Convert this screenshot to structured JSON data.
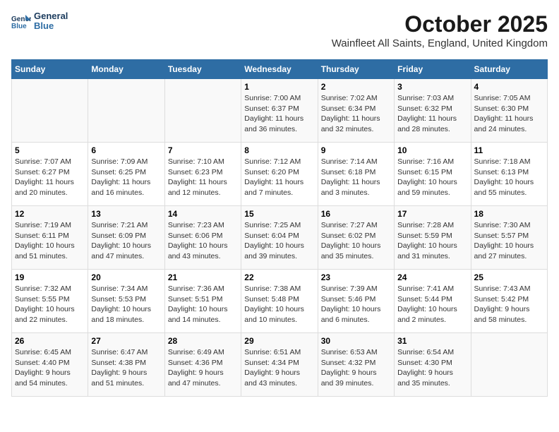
{
  "logo": {
    "line1": "General",
    "line2": "Blue"
  },
  "title": "October 2025",
  "subtitle": "Wainfleet All Saints, England, United Kingdom",
  "days_of_week": [
    "Sunday",
    "Monday",
    "Tuesday",
    "Wednesday",
    "Thursday",
    "Friday",
    "Saturday"
  ],
  "weeks": [
    [
      {
        "day": "",
        "info": ""
      },
      {
        "day": "",
        "info": ""
      },
      {
        "day": "",
        "info": ""
      },
      {
        "day": "1",
        "info": "Sunrise: 7:00 AM\nSunset: 6:37 PM\nDaylight: 11 hours\nand 36 minutes."
      },
      {
        "day": "2",
        "info": "Sunrise: 7:02 AM\nSunset: 6:34 PM\nDaylight: 11 hours\nand 32 minutes."
      },
      {
        "day": "3",
        "info": "Sunrise: 7:03 AM\nSunset: 6:32 PM\nDaylight: 11 hours\nand 28 minutes."
      },
      {
        "day": "4",
        "info": "Sunrise: 7:05 AM\nSunset: 6:30 PM\nDaylight: 11 hours\nand 24 minutes."
      }
    ],
    [
      {
        "day": "5",
        "info": "Sunrise: 7:07 AM\nSunset: 6:27 PM\nDaylight: 11 hours\nand 20 minutes."
      },
      {
        "day": "6",
        "info": "Sunrise: 7:09 AM\nSunset: 6:25 PM\nDaylight: 11 hours\nand 16 minutes."
      },
      {
        "day": "7",
        "info": "Sunrise: 7:10 AM\nSunset: 6:23 PM\nDaylight: 11 hours\nand 12 minutes."
      },
      {
        "day": "8",
        "info": "Sunrise: 7:12 AM\nSunset: 6:20 PM\nDaylight: 11 hours\nand 7 minutes."
      },
      {
        "day": "9",
        "info": "Sunrise: 7:14 AM\nSunset: 6:18 PM\nDaylight: 11 hours\nand 3 minutes."
      },
      {
        "day": "10",
        "info": "Sunrise: 7:16 AM\nSunset: 6:15 PM\nDaylight: 10 hours\nand 59 minutes."
      },
      {
        "day": "11",
        "info": "Sunrise: 7:18 AM\nSunset: 6:13 PM\nDaylight: 10 hours\nand 55 minutes."
      }
    ],
    [
      {
        "day": "12",
        "info": "Sunrise: 7:19 AM\nSunset: 6:11 PM\nDaylight: 10 hours\nand 51 minutes."
      },
      {
        "day": "13",
        "info": "Sunrise: 7:21 AM\nSunset: 6:09 PM\nDaylight: 10 hours\nand 47 minutes."
      },
      {
        "day": "14",
        "info": "Sunrise: 7:23 AM\nSunset: 6:06 PM\nDaylight: 10 hours\nand 43 minutes."
      },
      {
        "day": "15",
        "info": "Sunrise: 7:25 AM\nSunset: 6:04 PM\nDaylight: 10 hours\nand 39 minutes."
      },
      {
        "day": "16",
        "info": "Sunrise: 7:27 AM\nSunset: 6:02 PM\nDaylight: 10 hours\nand 35 minutes."
      },
      {
        "day": "17",
        "info": "Sunrise: 7:28 AM\nSunset: 5:59 PM\nDaylight: 10 hours\nand 31 minutes."
      },
      {
        "day": "18",
        "info": "Sunrise: 7:30 AM\nSunset: 5:57 PM\nDaylight: 10 hours\nand 27 minutes."
      }
    ],
    [
      {
        "day": "19",
        "info": "Sunrise: 7:32 AM\nSunset: 5:55 PM\nDaylight: 10 hours\nand 22 minutes."
      },
      {
        "day": "20",
        "info": "Sunrise: 7:34 AM\nSunset: 5:53 PM\nDaylight: 10 hours\nand 18 minutes."
      },
      {
        "day": "21",
        "info": "Sunrise: 7:36 AM\nSunset: 5:51 PM\nDaylight: 10 hours\nand 14 minutes."
      },
      {
        "day": "22",
        "info": "Sunrise: 7:38 AM\nSunset: 5:48 PM\nDaylight: 10 hours\nand 10 minutes."
      },
      {
        "day": "23",
        "info": "Sunrise: 7:39 AM\nSunset: 5:46 PM\nDaylight: 10 hours\nand 6 minutes."
      },
      {
        "day": "24",
        "info": "Sunrise: 7:41 AM\nSunset: 5:44 PM\nDaylight: 10 hours\nand 2 minutes."
      },
      {
        "day": "25",
        "info": "Sunrise: 7:43 AM\nSunset: 5:42 PM\nDaylight: 9 hours\nand 58 minutes."
      }
    ],
    [
      {
        "day": "26",
        "info": "Sunrise: 6:45 AM\nSunset: 4:40 PM\nDaylight: 9 hours\nand 54 minutes."
      },
      {
        "day": "27",
        "info": "Sunrise: 6:47 AM\nSunset: 4:38 PM\nDaylight: 9 hours\nand 51 minutes."
      },
      {
        "day": "28",
        "info": "Sunrise: 6:49 AM\nSunset: 4:36 PM\nDaylight: 9 hours\nand 47 minutes."
      },
      {
        "day": "29",
        "info": "Sunrise: 6:51 AM\nSunset: 4:34 PM\nDaylight: 9 hours\nand 43 minutes."
      },
      {
        "day": "30",
        "info": "Sunrise: 6:53 AM\nSunset: 4:32 PM\nDaylight: 9 hours\nand 39 minutes."
      },
      {
        "day": "31",
        "info": "Sunrise: 6:54 AM\nSunset: 4:30 PM\nDaylight: 9 hours\nand 35 minutes."
      },
      {
        "day": "",
        "info": ""
      }
    ]
  ]
}
